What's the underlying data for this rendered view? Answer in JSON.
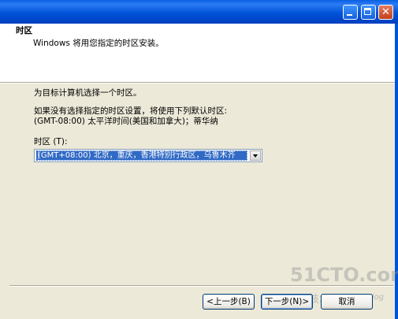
{
  "window": {
    "controls": {
      "minimize": "minimize",
      "maximize": "maximize",
      "close": "✕"
    }
  },
  "header": {
    "title": "时区",
    "subtitle": "Windows 将用您指定的时区安装。"
  },
  "body": {
    "instruction": "为目标计算机选择一个时区。",
    "default_note_line1": "如果没有选择指定的时区设置，将使用下列默认时区:",
    "default_note_line2": "(GMT-08:00) 太平洋时间(美国和加拿大)；蒂华纳",
    "timezone_label": "时区 (T):",
    "timezone_value": "(GMT+08:00) 北京，重庆，香港特别行政区，乌鲁木齐"
  },
  "buttons": {
    "back": "<上一步(B)",
    "next": "下一步(N)>",
    "cancel": "取消"
  },
  "watermark": {
    "main": "51CTO.com",
    "sub": "技术博客",
    "blog": "Blog"
  }
}
